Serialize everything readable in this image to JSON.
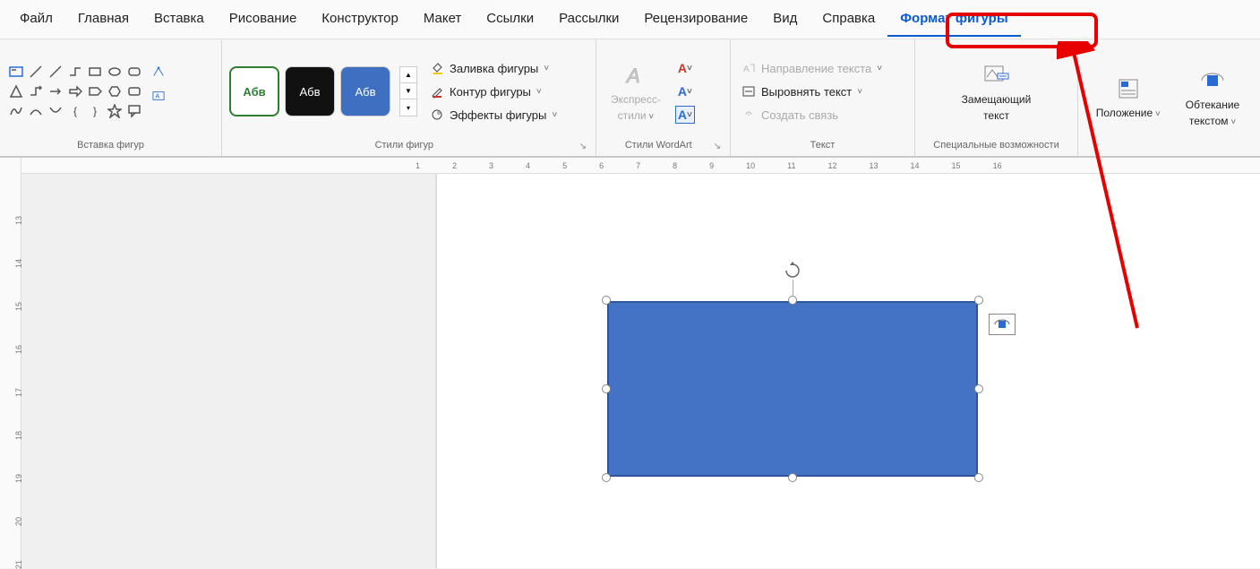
{
  "tabs": {
    "items": [
      {
        "label": "Файл"
      },
      {
        "label": "Главная"
      },
      {
        "label": "Вставка"
      },
      {
        "label": "Рисование"
      },
      {
        "label": "Конструктор"
      },
      {
        "label": "Макет"
      },
      {
        "label": "Ссылки"
      },
      {
        "label": "Рассылки"
      },
      {
        "label": "Рецензирование"
      },
      {
        "label": "Вид"
      },
      {
        "label": "Справка"
      },
      {
        "label": "Формат фигуры"
      }
    ]
  },
  "groups": {
    "insert_shapes": "Вставка фигур",
    "shape_styles": "Стили фигур",
    "wordart_styles": "Стили WordArt",
    "text": "Текст",
    "accessibility": "Специальные возможности"
  },
  "preset_label": "Абв",
  "shape_menu": {
    "fill": "Заливка фигуры",
    "outline": "Контур фигуры",
    "effects": "Эффекты фигуры"
  },
  "wordart": {
    "quick_styles_l1": "Экспресс-",
    "quick_styles_l2": "стили"
  },
  "text_menu": {
    "direction": "Направление текста",
    "align": "Выровнять текст",
    "link": "Создать связь"
  },
  "alt_text_l1": "Замещающий",
  "alt_text_l2": "текст",
  "position": "Положение",
  "wrap_l1": "Обтекание",
  "wrap_l2": "текстом",
  "ruler_h": [
    "1",
    "2",
    "3",
    "4",
    "5",
    "6",
    "7",
    "8",
    "9",
    "10",
    "11",
    "12",
    "13",
    "14",
    "15",
    "16"
  ],
  "ruler_v": [
    "13",
    "14",
    "15",
    "16",
    "17",
    "18",
    "19",
    "20",
    "21"
  ]
}
